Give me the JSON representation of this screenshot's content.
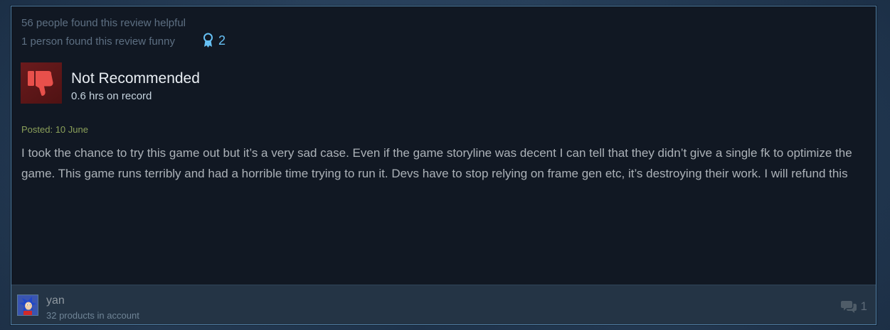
{
  "review": {
    "helpful_text": "56 people found this review helpful",
    "funny_text": "1 person found this review funny",
    "award_count": "2",
    "verdict": "Not Recommended",
    "hours": "0.6 hrs on record",
    "posted": "Posted: 10 June",
    "body": "I took the chance to try this game out but it’s a very sad case. Even if the game storyline was decent I can tell that they didn’t give a single fk to optimize the game. This game runs terribly and had a horrible time trying to run it. Devs have to stop relying on frame gen etc, it’s destroying their work. I will refund this"
  },
  "author": {
    "name": "yan",
    "products": "32 products in account"
  },
  "footer": {
    "comment_count": "1"
  },
  "icons": {
    "award": "award-ribbon-icon",
    "verdict": "thumbs-down-icon",
    "comments": "comment-bubbles-icon"
  },
  "colors": {
    "accent": "#66c0f4",
    "negative": "#6b1b1d",
    "posted": "#8ba05a"
  }
}
